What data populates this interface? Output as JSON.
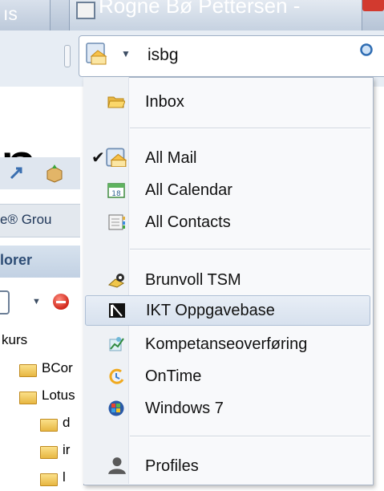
{
  "window": {
    "left_tab_fragment": "ıs",
    "main_tab_title": "Rogne Bø Pettersen -"
  },
  "search": {
    "value": "isbg"
  },
  "background": {
    "big_letter": "n",
    "group_label": "e® Grou",
    "explorer_label": "lorer",
    "tree": [
      {
        "label": "kurs"
      },
      {
        "label": "BCor"
      },
      {
        "label": "Lotus"
      },
      {
        "label": "d"
      },
      {
        "label": "ir"
      },
      {
        "label": "l"
      }
    ]
  },
  "menu": {
    "items": [
      {
        "label": "Inbox",
        "icon": "folder-open-icon",
        "checked": false
      },
      {
        "label": "All Mail",
        "icon": "mail-icon",
        "checked": true
      },
      {
        "label": "All Calendar",
        "icon": "calendar-icon",
        "checked": false
      },
      {
        "label": "All Contacts",
        "icon": "contacts-icon",
        "checked": false
      },
      {
        "label": "Brunvoll TSM",
        "icon": "database-icon",
        "checked": false
      },
      {
        "label": "IKT Oppgavebase",
        "icon": "book-icon",
        "checked": false
      },
      {
        "label": "Kompetanseoverføring",
        "icon": "graph-icon",
        "checked": false
      },
      {
        "label": "OnTime",
        "icon": "ontime-icon",
        "checked": false
      },
      {
        "label": "Windows 7",
        "icon": "windows-icon",
        "checked": false
      },
      {
        "label": "Profiles",
        "icon": "person-icon",
        "checked": false
      }
    ],
    "check_glyph": "✔"
  },
  "colors": {
    "accent": "#2d4c75",
    "menu_hover": "#d7e1ee"
  }
}
